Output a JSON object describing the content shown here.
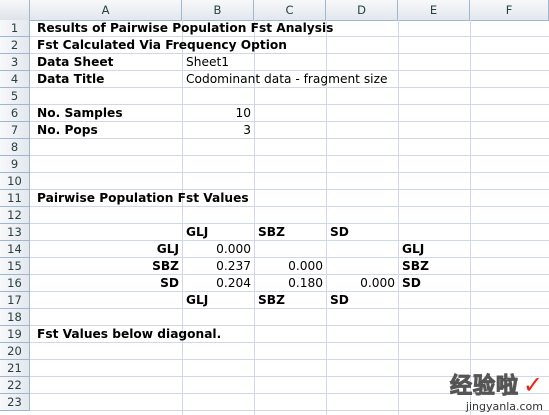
{
  "columns": [
    "A",
    "B",
    "C",
    "D",
    "E",
    "F"
  ],
  "rows": [
    "1",
    "2",
    "3",
    "4",
    "5",
    "6",
    "7",
    "8",
    "9",
    "10",
    "11",
    "12",
    "13",
    "14",
    "15",
    "16",
    "17",
    "18",
    "19",
    "20",
    "21",
    "22",
    "23"
  ],
  "cells": {
    "A1": "Results of Pairwise Population Fst Analysis",
    "A2": "Fst Calculated Via Frequency Option",
    "A3": "Data Sheet",
    "B3": "Sheet1",
    "A4": "Data Title",
    "B4": "Codominant data - fragment size",
    "A6": "No. Samples",
    "B6": "10",
    "A7": "No. Pops",
    "B7": "3",
    "A11": "Pairwise Population Fst Values",
    "B13": "GLJ",
    "C13": "SBZ",
    "D13": "SD",
    "A14": "GLJ",
    "B14": "0.000",
    "E14": "GLJ",
    "A15": "SBZ",
    "B15": "0.237",
    "C15": "0.000",
    "E15": "SBZ",
    "A16": "SD",
    "B16": "0.204",
    "C16": "0.180",
    "D16": "0.000",
    "E16": "SD",
    "B17": "GLJ",
    "C17": "SBZ",
    "D17": "SD",
    "A19": "Fst Values below diagonal."
  },
  "watermark": {
    "cn": "经验啦",
    "en": "jingyanla.com",
    "check": "✓"
  }
}
